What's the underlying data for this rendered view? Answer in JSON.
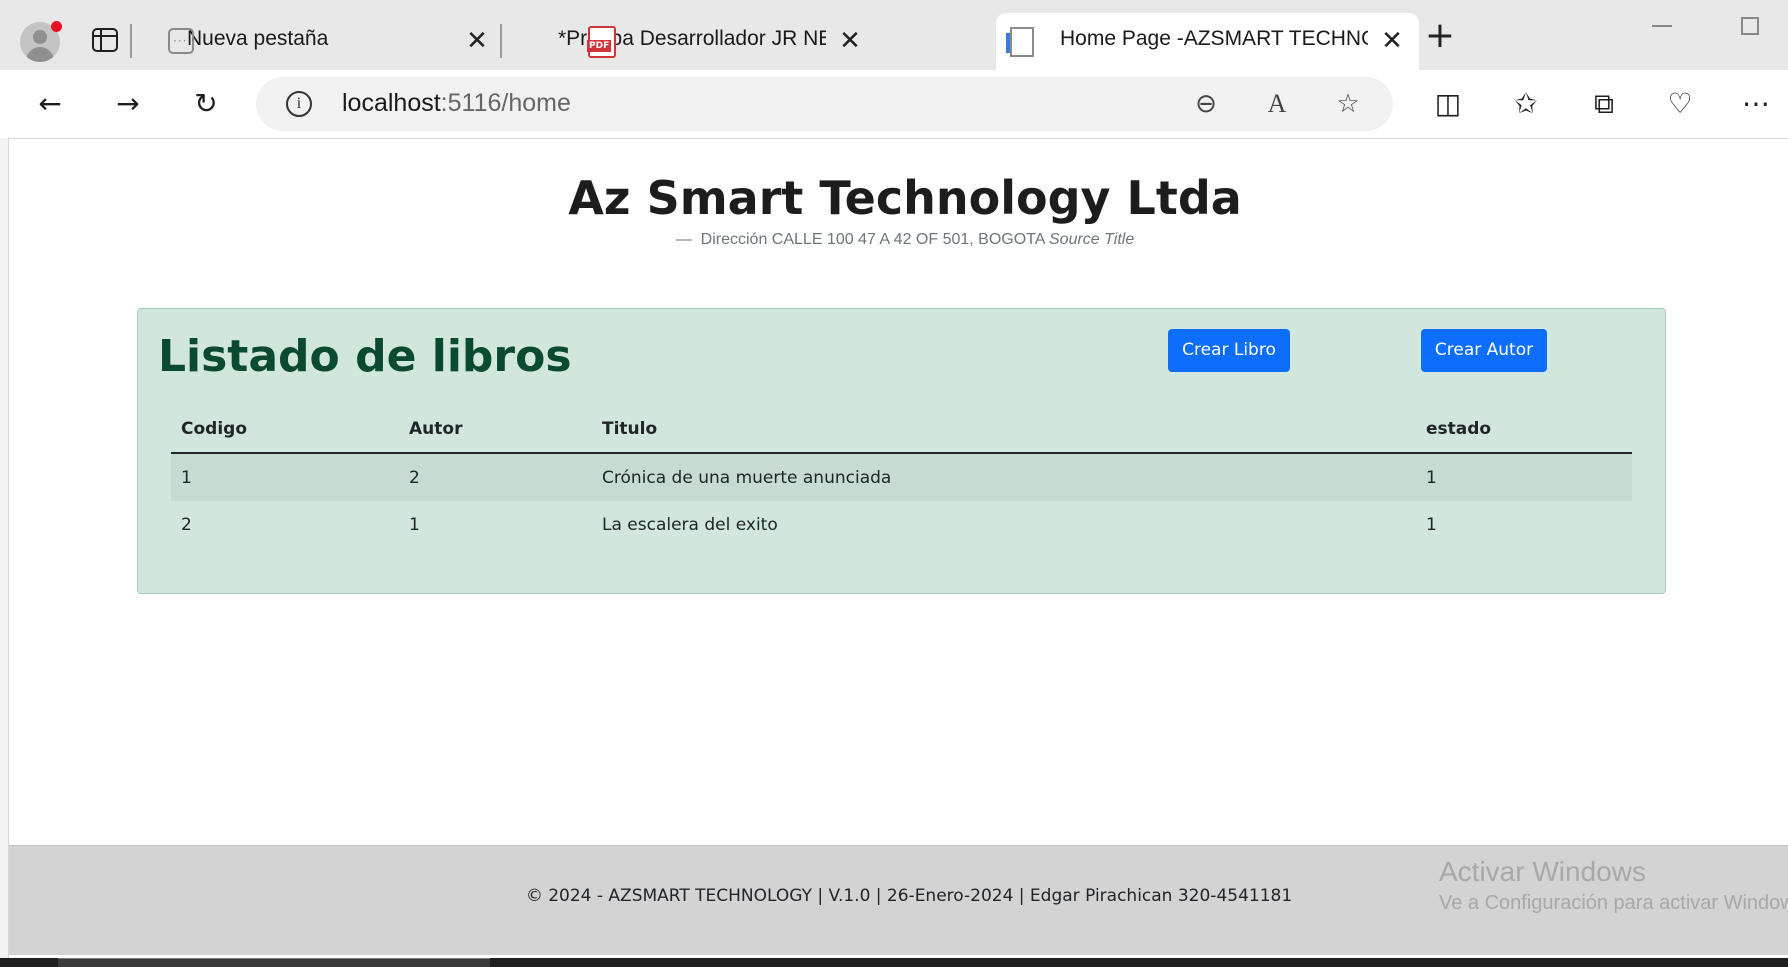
{
  "browser": {
    "tabs": [
      {
        "title": "Nueva pestaña",
        "favicon": "new-tab-icon"
      },
      {
        "title": "*Prueba Desarrollador JR NET.pdf",
        "favicon": "pdf-icon"
      },
      {
        "title": "Home Page -AZSMART TECHNOLOGY",
        "favicon": "document-icon",
        "active": true
      }
    ],
    "close_glyph": "✕",
    "new_tab_glyph": "+",
    "address": {
      "host": "localhost",
      "path": ":5116/home"
    }
  },
  "page": {
    "site_title": "Az Smart Technology Ltda",
    "subtitle_dash": "—",
    "subtitle_address": "Dirección CALLE 100 47 A 42 OF 501, BOGOTA",
    "subtitle_source": "Source Title",
    "panel": {
      "title": "Listado de libros",
      "buttons": {
        "crear_libro": "Crear Libro",
        "crear_autor": "Crear Autor"
      },
      "table": {
        "headers": [
          "Codigo",
          "Autor",
          "Titulo",
          "estado"
        ],
        "rows": [
          [
            "1",
            "2",
            "Crónica de una muerte anunciada",
            "1"
          ],
          [
            "2",
            "1",
            "La escalera del exito",
            "1"
          ]
        ]
      }
    },
    "footer": "© 2024 - AZSMART TECHNOLOGY | V.1.0 | 26-Enero-2024 | Edgar Pirachican 320-4541181",
    "watermark": {
      "title": "Activar Windows",
      "subtitle": "Ve a Configuración para activar Windows."
    }
  },
  "colors": {
    "primary_button": "#0d6efd",
    "panel_bg": "#d1e7dd",
    "panel_title": "#0a4a2e",
    "footer_bg": "#d3d3d3"
  }
}
